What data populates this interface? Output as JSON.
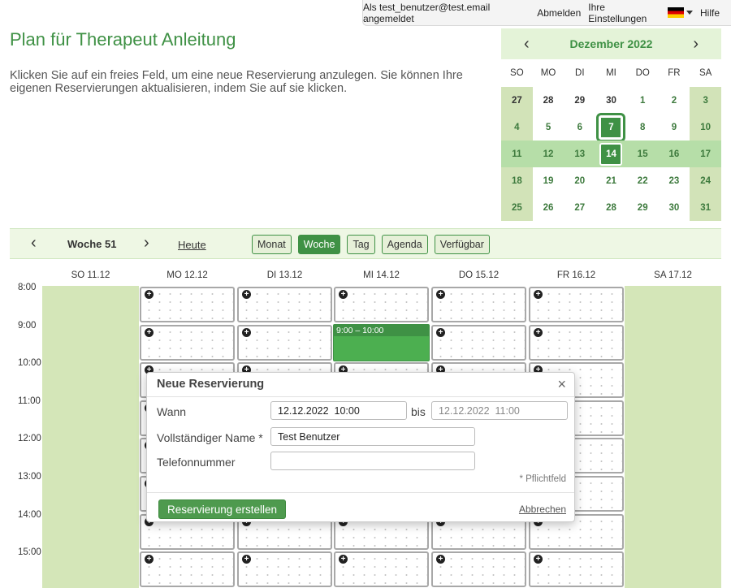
{
  "topbar": {
    "logged_in_as": "Als test_benutzer@test.email angemeldet",
    "logout": "Abmelden",
    "settings": "Ihre Einstellungen",
    "help": "Hilfe",
    "flag_icon": "germany-flag-icon"
  },
  "page": {
    "title": "Plan für Therapeut Anleitung",
    "intro": "Klicken Sie auf ein freies Feld, um eine neue Reservierung anzulegen. Sie können Ihre eigenen Reservierungen aktualisieren, indem Sie auf sie klicken."
  },
  "minical": {
    "month": "Dezember 2022",
    "prev": "‹",
    "next": "›",
    "dow": [
      "SO",
      "MO",
      "DI",
      "MI",
      "DO",
      "FR",
      "SA"
    ],
    "weeks": [
      [
        "27",
        "28",
        "29",
        "30",
        "1",
        "2",
        "3"
      ],
      [
        "4",
        "5",
        "6",
        "7",
        "8",
        "9",
        "10"
      ],
      [
        "11",
        "12",
        "13",
        "14",
        "15",
        "16",
        "17"
      ],
      [
        "18",
        "19",
        "20",
        "21",
        "22",
        "23",
        "24"
      ],
      [
        "25",
        "26",
        "27",
        "28",
        "29",
        "30",
        "31"
      ]
    ]
  },
  "toolbar": {
    "prev": "‹",
    "next": "›",
    "week": "Woche 51",
    "today": "Heute",
    "views": [
      "Monat",
      "Woche",
      "Tag",
      "Agenda",
      "Verfügbar"
    ],
    "active_view": "Woche"
  },
  "week": {
    "days": [
      "SO 11.12",
      "MO 12.12",
      "DI 13.12",
      "MI 14.12",
      "DO 15.12",
      "FR 16.12",
      "SA 17.12"
    ],
    "times": [
      "8:00",
      "9:00",
      "10:00",
      "11:00",
      "12:00",
      "13:00",
      "14:00",
      "15:00"
    ],
    "event": {
      "time": "9:00 – 10:00"
    }
  },
  "dialog": {
    "title": "Neue Reservierung",
    "close": "×",
    "when_label": "Wann",
    "from_value": "12.12.2022  10:00",
    "bis": "bis",
    "to_value": "12.12.2022  11:00",
    "name_label": "Vollständiger Name *",
    "name_value": "Test Benutzer",
    "phone_label": "Telefonnummer",
    "phone_value": "",
    "required_note": "* Pflichtfeld",
    "submit": "Reservierung erstellen",
    "cancel": "Abbrechen"
  },
  "colors": {
    "brand_green": "#3f9145",
    "light_green": "#eef7e4",
    "weekend_green": "#d4e6b8"
  }
}
